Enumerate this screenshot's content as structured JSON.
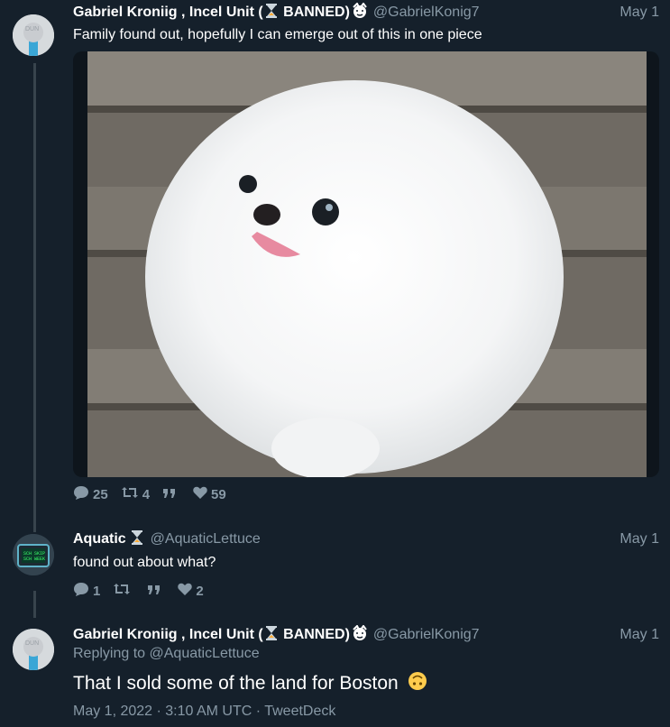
{
  "tweets": [
    {
      "author": "Gabriel Kroniig , Incel Unit (",
      "author_suffix": " BANNED)",
      "handle": "@GabrielKonig7",
      "date": "May 1",
      "text": "Family found out, hopefully I can emerge out of this in one piece",
      "stats": {
        "replies": "25",
        "retweets": "4",
        "likes": "59"
      }
    },
    {
      "author": "Aquatic",
      "handle": "@AquaticLettuce",
      "date": "May 1",
      "text": "found out about what?",
      "stats": {
        "replies": "1",
        "likes": "2"
      }
    },
    {
      "author": "Gabriel Kroniig , Incel Unit (",
      "author_suffix": " BANNED)",
      "handle": "@GabrielKonig7",
      "date": "May 1",
      "replying_label": "Replying to ",
      "replying_to": "@AquaticLettuce",
      "text": "That I sold some of the land for Boston",
      "timestamp": "May 1, 2022 · 3:10 AM UTC · TweetDeck"
    }
  ],
  "icons": [
    "reply-icon",
    "retweet-icon",
    "quote-icon",
    "like-icon",
    "hourglass-icon",
    "upside-down-face-icon"
  ],
  "colors": {
    "background": "#15202b",
    "muted": "#8899a6",
    "line": "#38444d"
  }
}
